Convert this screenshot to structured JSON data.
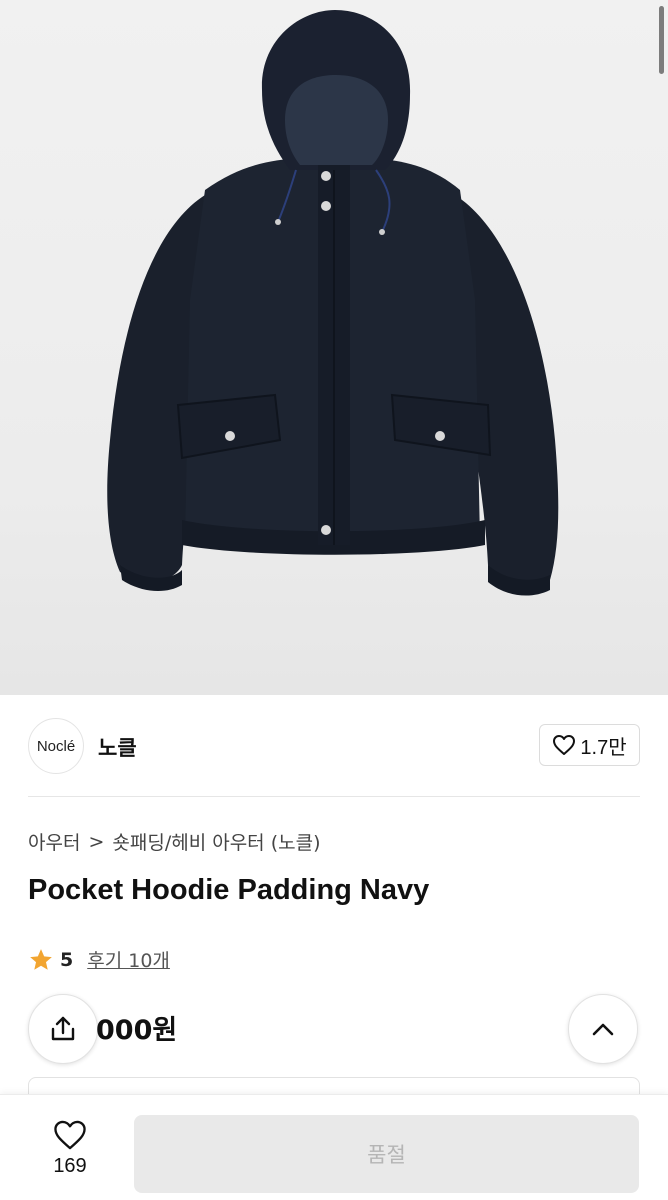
{
  "brand": {
    "logo_text": "Noclé",
    "name": "노클",
    "like_count": "1.7만"
  },
  "breadcrumb": {
    "level1": "아우터",
    "separator": ">",
    "level2": "숏패딩/헤비 아우터 (노클)"
  },
  "product": {
    "title": "Pocket Hoodie Padding Navy",
    "rating": "5",
    "reviews": "후기 10개",
    "price": "000원"
  },
  "bottom": {
    "wish_count": "169",
    "buy_label": "품절"
  },
  "colors": {
    "star": "#f2a531",
    "jacket": "#1b2230",
    "disabled_button": "#e9e9e9"
  },
  "icons": {
    "like": "heart-outline-icon",
    "star": "star-icon",
    "share": "share-icon",
    "up": "chevron-up-icon",
    "wish": "heart-outline-icon"
  }
}
